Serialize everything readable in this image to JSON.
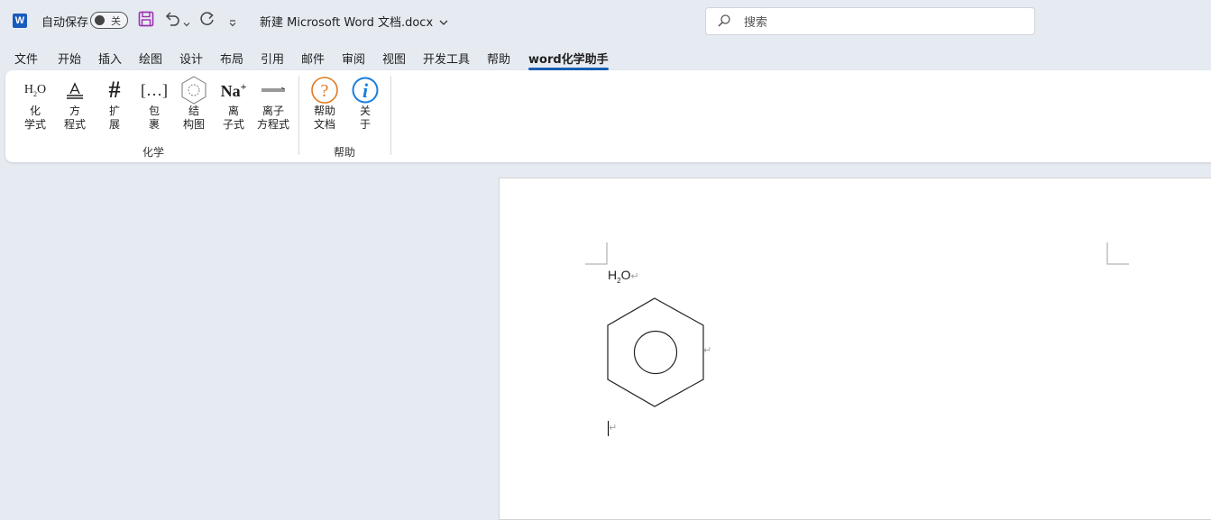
{
  "titlebar": {
    "app_icon_letter": "W",
    "autosave_label": "自动保存",
    "autosave_state": "关",
    "doc_title": "新建 Microsoft Word 文档.docx",
    "search_placeholder": "搜索"
  },
  "menu": {
    "tabs": [
      "文件",
      "开始",
      "插入",
      "绘图",
      "设计",
      "布局",
      "引用",
      "邮件",
      "审阅",
      "视图",
      "开发工具",
      "帮助",
      "word化学助手"
    ],
    "active_tab": "word化学助手"
  },
  "ribbon": {
    "groups": [
      {
        "label": "化学",
        "buttons": [
          {
            "label": "化\n学式",
            "icon": "chemical-formula-icon"
          },
          {
            "label": "方\n程式",
            "icon": "equation-icon"
          },
          {
            "label": "扩\n展",
            "icon": "hash-icon"
          },
          {
            "label": "包\n裹",
            "icon": "brackets-icon"
          },
          {
            "label": "结\n构图",
            "icon": "benzene-structure-icon"
          },
          {
            "label": "离\n子式",
            "icon": "ion-icon"
          },
          {
            "label": "离子\n方程式",
            "icon": "ionic-equation-icon"
          }
        ]
      },
      {
        "label": "帮助",
        "buttons": [
          {
            "label": "帮助\n文档",
            "icon": "help-question-icon"
          },
          {
            "label": "关\n于",
            "icon": "info-icon"
          }
        ]
      }
    ],
    "icon_text": {
      "h2o_main": "H",
      "h2o_sub": "2",
      "h2o_end": "O",
      "hash": "#",
      "brackets": "[…]",
      "na": "Na",
      "na_charge": "+",
      "question": "?",
      "info": "i"
    }
  },
  "document": {
    "formula": {
      "main": "H",
      "sub": "2",
      "end": "O"
    },
    "paragraph_mark": "↵"
  },
  "colors": {
    "accent": "#1a5fb4",
    "word_blue": "#185abd",
    "save_purple": "#9b2fae",
    "help_orange": "#e07a1f",
    "info_blue": "#1a7de0"
  }
}
